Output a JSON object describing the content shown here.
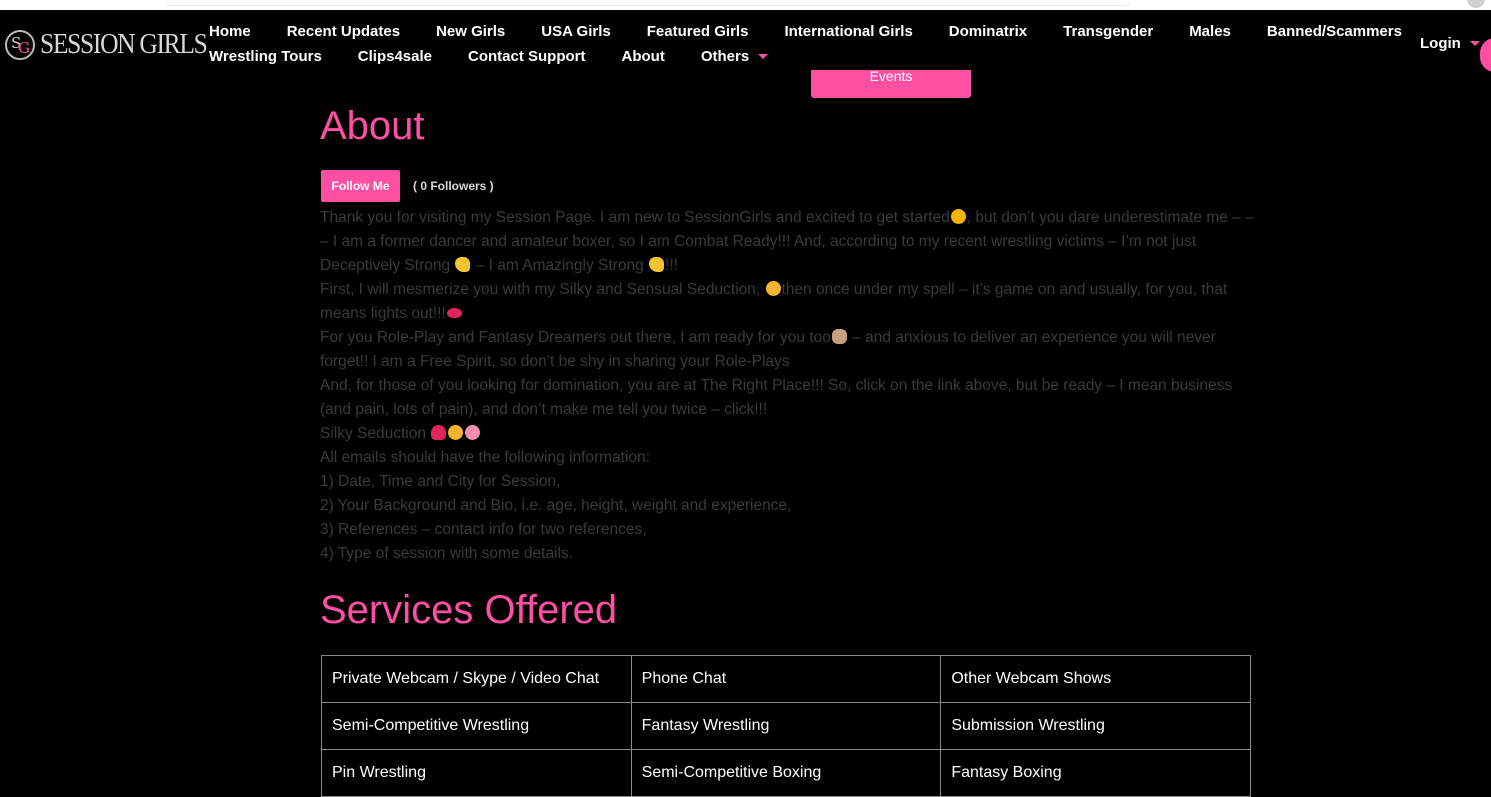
{
  "brand": {
    "logo_mark_s": "S",
    "logo_mark_g": "G",
    "name": "SESSION GIRLS"
  },
  "nav": {
    "row1": [
      "Home",
      "Recent Updates",
      "New Girls",
      "USA Girls",
      "Featured Girls",
      "International Girls",
      "Dominatrix",
      "Transgender",
      "Males",
      "Banned/Scammers"
    ],
    "row2": [
      "Wrestling Tours",
      "Clips4sale",
      "Contact Support",
      "About",
      "Others"
    ],
    "login": "Login"
  },
  "events_button": "Events",
  "about": {
    "heading": "About",
    "follow_label": "Follow Me",
    "followers_text": "( 0 Followers )",
    "p1a": "Thank you for visiting my Session Page. I am new to SessionGirls and excited to get started",
    "p1b": ", but don’t you dare underestimate me – – – I am a former dancer and amateur boxer, so I am Combat Ready!!!  And, according to my recent wrestling victims – I’m not just Deceptively Strong ",
    "p1c": " – I am Amazingly Strong ",
    "p1d": "!!!",
    "p2a": "First, I will mesmerize you with my Silky and Sensual Seduction, ",
    "p2b": "then once under my spell – it’s game on and usually, for you, that means lights out!!!",
    "p3a": "For you Role-Play and Fantasy Dreamers out there, I am ready for you too",
    "p3b": " – and anxious to deliver an experience you will never forget!! I am a Free Spirit, so don’t be shy in sharing your Role-Plays",
    "p4": "And, for those of you looking for domination, you are at The Right Place!!! So, click on the link above, but be ready – I mean business (and pain, lots of pain), and don’t make me tell you twice – click!!!",
    "p5": "Silky Seduction ",
    "p6": "All emails should have the following information:",
    "p7": "1) Date, Time and City for Session,",
    "p8": "2) Your Background and Bio, i.e. age, height, weight and experience,",
    "p9": "3) References – contact info for two references,",
    "p10": "4) Type of session with some details."
  },
  "services": {
    "heading": "Services Offered",
    "rows": [
      [
        "Private Webcam / Skype / Video Chat",
        "Phone Chat",
        "Other Webcam Shows"
      ],
      [
        "Semi-Competitive Wrestling",
        "Fantasy Wrestling",
        "Submission Wrestling"
      ],
      [
        "Pin Wrestling",
        "Semi-Competitive Boxing",
        "Fantasy Boxing"
      ]
    ]
  },
  "colors": {
    "accent": "#ff4fa3",
    "background": "#000000",
    "body_text": "#3a3a3a"
  }
}
